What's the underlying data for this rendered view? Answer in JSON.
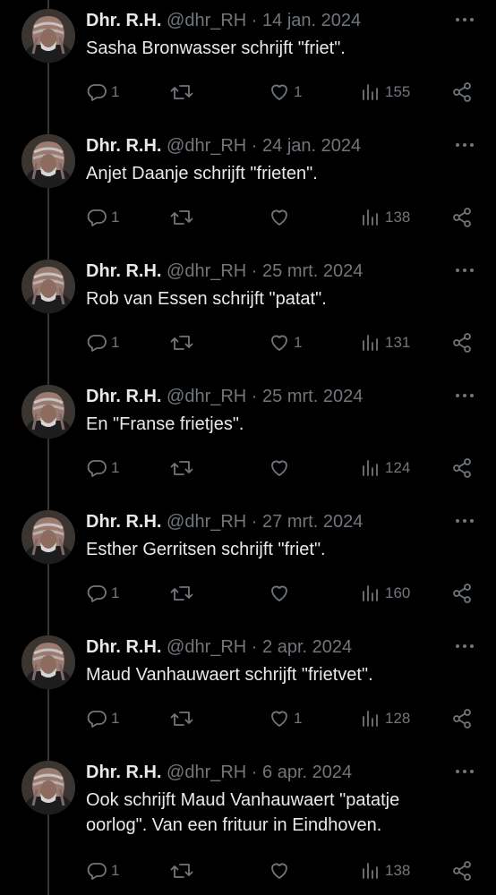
{
  "colors": {
    "background": "#000000",
    "text": "#e7e9ea",
    "muted": "#71767b",
    "thread_line": "#333639"
  },
  "tweets": [
    {
      "name": "Dhr. R.H.",
      "handle": "@dhr_RH",
      "sep": "·",
      "date": "14 jan. 2024",
      "lines": [
        "Sasha Bronwasser schrijft \"friet\"."
      ],
      "replies": "1",
      "retweets": "",
      "likes": "1",
      "views": "155"
    },
    {
      "name": "Dhr. R.H.",
      "handle": "@dhr_RH",
      "sep": "·",
      "date": "24 jan. 2024",
      "lines": [
        "Anjet Daanje schrijft \"frieten\"."
      ],
      "replies": "1",
      "retweets": "",
      "likes": "",
      "views": "138"
    },
    {
      "name": "Dhr. R.H.",
      "handle": "@dhr_RH",
      "sep": "·",
      "date": "25 mrt. 2024",
      "lines": [
        "Rob van Essen schrijft \"patat\"."
      ],
      "replies": "1",
      "retweets": "",
      "likes": "1",
      "views": "131"
    },
    {
      "name": "Dhr. R.H.",
      "handle": "@dhr_RH",
      "sep": "·",
      "date": "25 mrt. 2024",
      "lines": [
        "En \"Franse frietjes\"."
      ],
      "replies": "1",
      "retweets": "",
      "likes": "",
      "views": "124"
    },
    {
      "name": "Dhr. R.H.",
      "handle": "@dhr_RH",
      "sep": "·",
      "date": "27 mrt. 2024",
      "lines": [
        "Esther Gerritsen schrijft \"friet\"."
      ],
      "replies": "1",
      "retweets": "",
      "likes": "",
      "views": "160"
    },
    {
      "name": "Dhr. R.H.",
      "handle": "@dhr_RH",
      "sep": "·",
      "date": "2 apr. 2024",
      "lines": [
        "Maud Vanhauwaert schrijft \"frietvet\"."
      ],
      "replies": "1",
      "retweets": "",
      "likes": "1",
      "views": "128"
    },
    {
      "name": "Dhr. R.H.",
      "handle": "@dhr_RH",
      "sep": "·",
      "date": "6 apr. 2024",
      "lines": [
        "Ook schrijft Maud Vanhauwaert \"patatje",
        "oorlog\". Van een frituur in Eindhoven."
      ],
      "replies": "1",
      "retweets": "",
      "likes": "",
      "views": "138"
    }
  ],
  "icons": {
    "reply": "reply-icon",
    "retweet": "retweet-icon",
    "like": "heart-icon",
    "views": "views-icon",
    "share": "share-icon",
    "more": "more-icon"
  }
}
